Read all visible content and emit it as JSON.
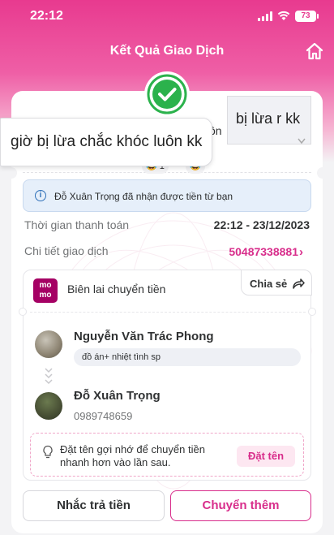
{
  "status_bar": {
    "time": "22:12",
    "battery": "73"
  },
  "header": {
    "title": "Kết Quả Giao Dịch"
  },
  "chat_overlay": {
    "bubble_left": "giờ bị lừa chắc khóc luôn kk",
    "bubble_right": "bị lừa r kk",
    "behind_text": "ôn",
    "reactions": [
      {
        "emoji": "😂",
        "count": "1"
      },
      {
        "emoji": "😂",
        "count": ""
      }
    ]
  },
  "notice": {
    "text": "Đỗ Xuân Trọng đã nhận được tiền từ bạn"
  },
  "details": {
    "time_label": "Thời gian thanh toán",
    "time_value": "22:12 - 23/12/2023",
    "tx_label": "Chi tiết giao dịch",
    "tx_value": "50487338881"
  },
  "receipt": {
    "logo_text": "mo mo",
    "title": "Biên lai chuyển tiền",
    "share_label": "Chia sẻ",
    "sender_name": "Nguyễn Văn Trác Phong",
    "memo": "đồ án+ nhiệt tình sp",
    "receiver_name": "Đỗ Xuân Trọng",
    "receiver_phone": "0989748659",
    "nickname_hint": "Đặt tên gợi nhớ để chuyển tiền nhanh hơn vào lần sau.",
    "nickname_button": "Đặt tên"
  },
  "actions": {
    "remind": "Nhắc trả tiền",
    "transfer_more": "Chuyển thêm"
  },
  "colors": {
    "brand_pink": "#d82d8b",
    "momo_purple": "#a50064",
    "success_green": "#2bb24c",
    "info_blue": "#2d6fb8"
  }
}
